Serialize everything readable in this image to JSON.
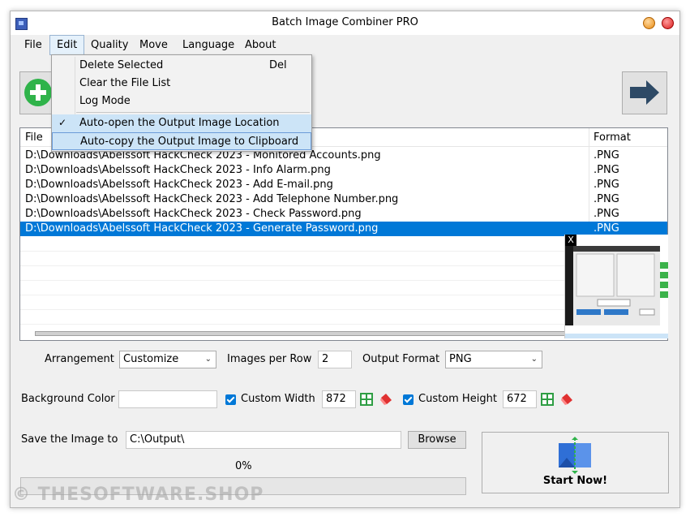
{
  "window": {
    "title": "Batch Image Combiner PRO"
  },
  "menubar": {
    "items": [
      {
        "label": "File"
      },
      {
        "label": "Edit"
      },
      {
        "label": "Quality"
      },
      {
        "label": "Move"
      },
      {
        "label": "Language"
      },
      {
        "label": "About"
      }
    ]
  },
  "edit_menu": {
    "items": [
      {
        "label": "Delete Selected",
        "shortcut": "Del"
      },
      {
        "label": "Clear the File List"
      },
      {
        "label": "Log Mode"
      },
      {
        "label": "Auto-open the Output Image Location",
        "checked": true
      },
      {
        "label": "Auto-copy the Output Image to Clipboard",
        "highlighted": true
      }
    ]
  },
  "file_list": {
    "columns": [
      "File",
      "Format"
    ],
    "rows": [
      {
        "file": "D:\\Downloads\\Abelssoft HackCheck 2023 - Monitored Accounts.png",
        "format": ".PNG"
      },
      {
        "file": "D:\\Downloads\\Abelssoft HackCheck 2023 - Info Alarm.png",
        "format": ".PNG"
      },
      {
        "file": "D:\\Downloads\\Abelssoft HackCheck 2023 - Add E-mail.png",
        "format": ".PNG"
      },
      {
        "file": "D:\\Downloads\\Abelssoft HackCheck 2023 - Add Telephone Number.png",
        "format": ".PNG"
      },
      {
        "file": "D:\\Downloads\\Abelssoft HackCheck 2023 - Check Password.png",
        "format": ".PNG"
      },
      {
        "file": "D:\\Downloads\\Abelssoft HackCheck 2023 - Generate Password.png",
        "format": ".PNG",
        "selected": true
      }
    ]
  },
  "preview": {
    "close_label": "X"
  },
  "settings": {
    "arrangement_label": "Arrangement",
    "arrangement_value": "Customize",
    "images_per_row_label": "Images per Row",
    "images_per_row_value": "2",
    "output_format_label": "Output Format",
    "output_format_value": "PNG",
    "background_color_label": "Background Color",
    "background_color_value": "",
    "custom_width_label": "Custom Width",
    "custom_width_value": "872",
    "custom_height_label": "Custom Height",
    "custom_height_value": "672",
    "save_label": "Save the Image to",
    "save_path": "C:\\Output\\",
    "browse_label": "Browse"
  },
  "progress": {
    "text": "0%",
    "value": 0
  },
  "start_button": {
    "label": "Start Now!"
  },
  "watermark": "© THESOFTWARE.SHOP",
  "colors": {
    "selection": "#0078d7",
    "accent_green": "#2fb34a",
    "arrow": "#2e4a66"
  }
}
